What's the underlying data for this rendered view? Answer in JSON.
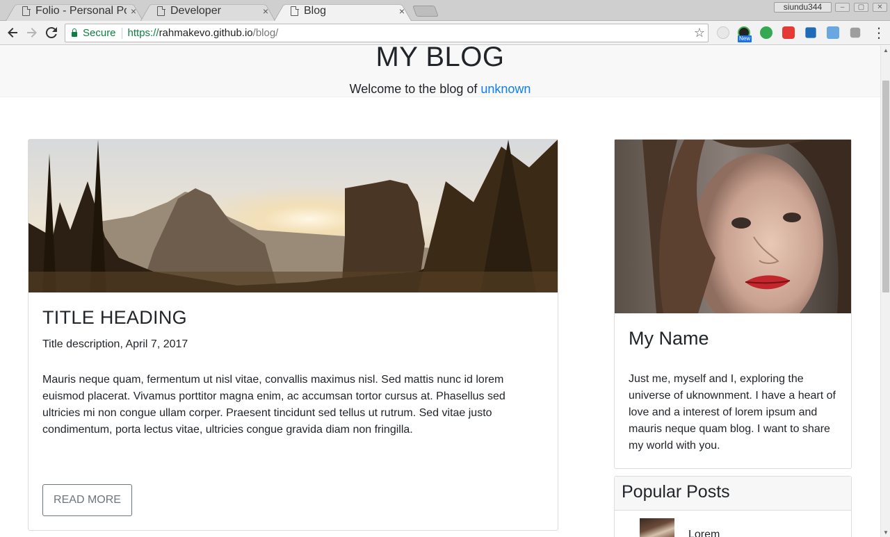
{
  "browser": {
    "tabs": [
      {
        "title": "Folio - Personal Po",
        "active": false
      },
      {
        "title": "Developer",
        "active": false
      },
      {
        "title": "Blog",
        "active": true
      }
    ],
    "user": "siundu344",
    "secure_label": "Secure",
    "url_scheme": "https://",
    "url_host": "rahmakevo.github.io",
    "url_path": "/blog/",
    "extension_badge": "New",
    "close_glyph": "×"
  },
  "hero": {
    "title": "MY BLOG",
    "welcome_text": "Welcome to the blog of ",
    "welcome_link": "unknown"
  },
  "post": {
    "title": "TITLE HEADING",
    "description": "Title description, April 7, 2017",
    "body": "Mauris neque quam, fermentum ut nisl vitae, convallis maximus nisl. Sed mattis nunc id lorem euismod placerat. Vivamus porttitor magna enim, ac accumsan tortor cursus at. Phasellus sed ultricies mi non congue ullam corper. Praesent tincidunt sed tellus ut rutrum. Sed vitae justo condimentum, porta lectus vitae, ultricies congue gravida diam non fringilla.",
    "read_more": "READ MORE"
  },
  "profile": {
    "name": "My Name",
    "bio": "Just me, myself and I, exploring the universe of uknownment. I have a heart of love and a interest of lorem ipsum and mauris neque quam blog. I want to share my world with you."
  },
  "popular": {
    "heading": "Popular Posts",
    "items": [
      {
        "title": "Lorem"
      }
    ]
  }
}
